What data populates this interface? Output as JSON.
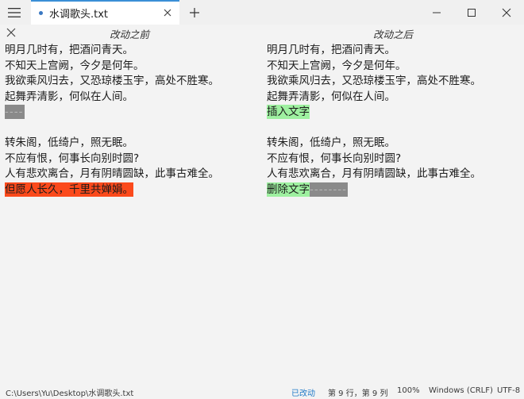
{
  "window": {
    "tab_title": "水调歌头.txt",
    "menu_icon": "hamburger-icon",
    "new_tab_icon": "plus-icon",
    "controls": [
      "minimize-icon",
      "maximize-icon",
      "close-icon"
    ]
  },
  "compare": {
    "close_icon": "close-icon",
    "left_title": "改动之前",
    "right_title": "改动之后"
  },
  "left_pane": {
    "lines": [
      {
        "text": "明月几时有，把酒问青天。",
        "highlight": null
      },
      {
        "text": "不知天上宫阙，今夕是何年。",
        "highlight": null
      },
      {
        "text": "我欲乘风归去，又恐琼楼玉宇，高处不胜寒。",
        "highlight": null
      },
      {
        "text": "起舞弄清影，何似在人间。",
        "highlight": null
      },
      {
        "text": "----",
        "highlight": "gray"
      },
      {
        "text": "",
        "highlight": null
      },
      {
        "text": "转朱阁，低绮户，照无眠。",
        "highlight": null
      },
      {
        "text": "不应有恨，何事长向别时圆?",
        "highlight": null
      },
      {
        "text": "人有悲欢离合，月有阴晴圆缺，此事古难全。",
        "highlight": null
      },
      {
        "text": "但愿人长久，千里共婵娟。",
        "highlight": "red"
      }
    ]
  },
  "right_pane": {
    "lines": [
      {
        "text": "明月几时有，把酒问青天。",
        "highlight": null
      },
      {
        "text": "不知天上宫阙，今夕是何年。",
        "highlight": null
      },
      {
        "text": "我欲乘风归去，又恐琼楼玉宇，高处不胜寒。",
        "highlight": null
      },
      {
        "text": "起舞弄清影，何似在人间。",
        "highlight": null
      },
      {
        "text": "插入文字",
        "highlight": "green"
      },
      {
        "text": "",
        "highlight": null
      },
      {
        "text": "转朱阁，低绮户，照无眠。",
        "highlight": null
      },
      {
        "text": "不应有恨，何事长向别时圆?",
        "highlight": null
      },
      {
        "text": "人有悲欢离合，月有阴晴圆缺，此事古难全。",
        "highlight": null
      },
      {
        "text": "删除文字",
        "highlight": "green",
        "suffix": "--------",
        "suffix_highlight": "gray"
      }
    ]
  },
  "statusbar": {
    "path": "C:\\Users\\Yu\\Desktop\\水调歌头.txt",
    "modified": "已改动",
    "position": "第 9 行，第 9 列",
    "zoom": "100%",
    "line_ending": "Windows (CRLF)",
    "encoding": "UTF-8"
  },
  "colors": {
    "tab_accent": "#3a8fd6",
    "deleted_red": "#fb4a1c",
    "inserted_green": "#9ef0a0",
    "placeholder_gray": "#8a8a8a",
    "modified_blue": "#1f7ac8"
  }
}
